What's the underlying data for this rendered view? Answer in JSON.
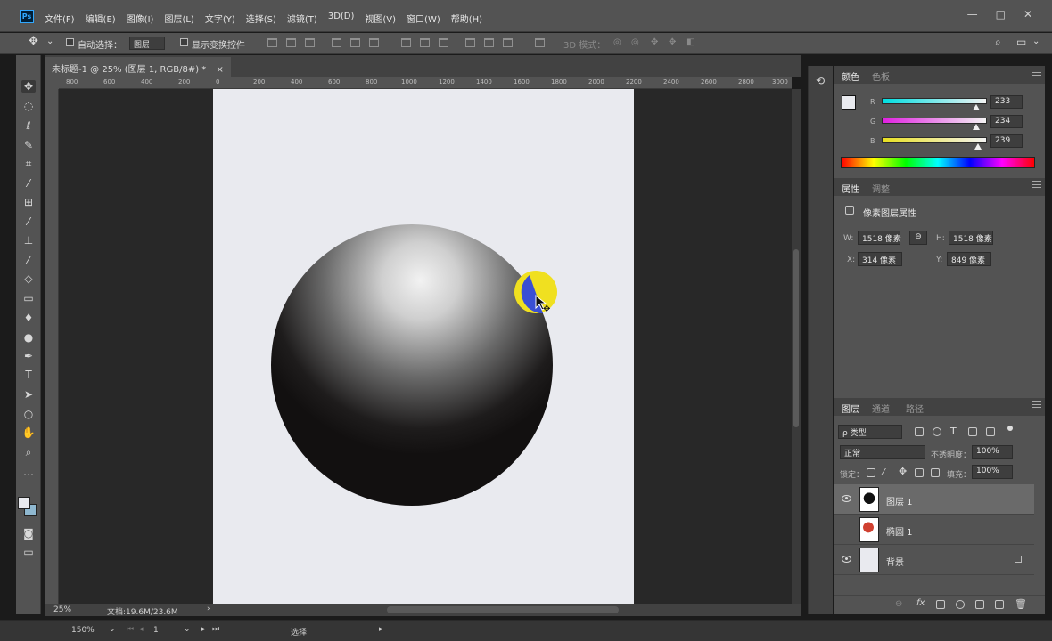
{
  "app": {
    "logo": "Ps",
    "menu": [
      "文件(F)",
      "编辑(E)",
      "图像(I)",
      "图层(L)",
      "文字(Y)",
      "选择(S)",
      "滤镜(T)",
      "3D(D)",
      "视图(V)",
      "窗口(W)",
      "帮助(H)"
    ],
    "window_controls": [
      "—",
      "□",
      "✕"
    ]
  },
  "options_bar": {
    "auto_select_label": "自动选择：",
    "auto_select_value": "图层",
    "show_transform_label": "显示变换控件",
    "mode_3d_label": "3D 模式："
  },
  "document": {
    "tab_title": "未标题-1 @ 25% (图层 1, RGB/8#) *",
    "ruler_ticks": [
      "800",
      "600",
      "400",
      "200",
      "0",
      "200",
      "400",
      "600",
      "800",
      "1000",
      "1200",
      "1400",
      "1600",
      "1800",
      "2000",
      "2200",
      "2400",
      "2600",
      "2800",
      "3000"
    ],
    "zoom": "25%",
    "doc_info": "文档:19.6M/23.6M",
    "canvas_color": "#e9eaef"
  },
  "timeline": {
    "zoom": "150%",
    "frame": "1",
    "label": "选择"
  },
  "color_panel": {
    "tabs": [
      "颜色",
      "色板"
    ],
    "channels": [
      {
        "label": "R",
        "value": "233",
        "fraction": 0.914,
        "gradient": "#29c8d8"
      },
      {
        "label": "G",
        "value": "234",
        "fraction": 0.918,
        "gradient": "#e040e0"
      },
      {
        "label": "B",
        "value": "239",
        "fraction": 0.937,
        "gradient": "#e8e030"
      }
    ],
    "foreground": "#e9eaef",
    "background": "#8fb8d0"
  },
  "properties_panel": {
    "tabs": [
      "属性",
      "调整"
    ],
    "title": "像素图层属性",
    "w_label": "W:",
    "w_value": "1518 像素",
    "h_label": "H:",
    "h_value": "1518 像素",
    "x_label": "X:",
    "x_value": "314 像素",
    "y_label": "Y:",
    "y_value": "849 像素"
  },
  "layers_panel": {
    "tabs": [
      "图层",
      "通道",
      "路径"
    ],
    "filter_label": "ρ 类型",
    "blend_mode": "正常",
    "opacity_label": "不透明度：",
    "opacity_value": "100%",
    "lock_label": "锁定：",
    "fill_label": "填充：",
    "fill_value": "100%",
    "layers": [
      {
        "name": "图层 1",
        "visible": true,
        "selected": true
      },
      {
        "name": "椭圆 1",
        "visible": false,
        "selected": false
      },
      {
        "name": "背景",
        "visible": true,
        "selected": false,
        "locked": true
      }
    ]
  }
}
